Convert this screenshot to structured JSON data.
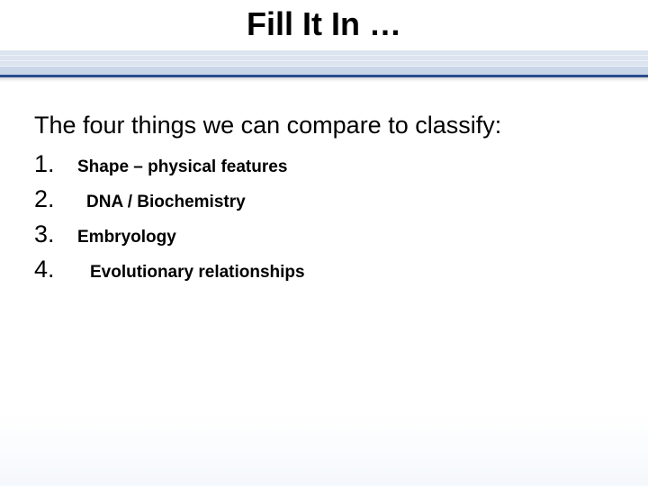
{
  "title": "Fill It In …",
  "intro": "The four things we can compare to classify:",
  "items": [
    {
      "num": "1.",
      "answer": "Shape – physical features"
    },
    {
      "num": "2.",
      "answer": "DNA / Biochemistry"
    },
    {
      "num": "3.",
      "answer": "Embryology"
    },
    {
      "num": "4.",
      "answer": "Evolutionary relationships"
    }
  ]
}
